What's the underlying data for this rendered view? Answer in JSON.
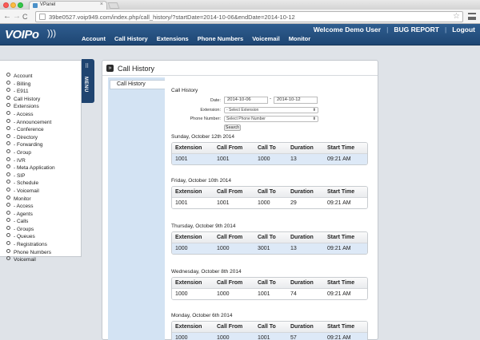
{
  "browser": {
    "tab_title": "VPanel",
    "tab_close": "×",
    "url": "39be0527.voip949.com/index.php/call_history/?startDate=2014-10-06&endDate=2014-10-12",
    "back": "←",
    "forward": "→",
    "reload": "C",
    "star": "☆"
  },
  "header": {
    "logo": "VOIPo",
    "logo_waves": ")))",
    "nav": [
      "Account",
      "Call History",
      "Extensions",
      "Phone Numbers",
      "Voicemail",
      "Monitor"
    ],
    "welcome": "Welcome Demo User",
    "sep1": "|",
    "bug_report": "BUG REPORT",
    "sep2": "|",
    "logout": "Logout"
  },
  "sidebar": {
    "menu_tab_label": "MENU",
    "menu_tab_icon": "⠿",
    "items": [
      "Account",
      "- Billing",
      "- E911",
      "Call History",
      "Extensions",
      "- Access",
      "- Announcement",
      "- Conference",
      "- Directory",
      "- Forwarding",
      "- Group",
      "- IVR",
      "- Meta Application",
      "- SIP",
      "- Schedule",
      "- Voicemail",
      "Monitor",
      "- Access",
      "- Agents",
      "- Calls",
      "- Groups",
      "- Queues",
      "- Registrations",
      "Phone Numbers",
      "Voicemail"
    ]
  },
  "panel": {
    "title": "Call History",
    "icon": "»",
    "subnav_item": "Call History",
    "section_title": "Call History",
    "date_label": "Date:",
    "start_date": "2014-10-06",
    "date_sep": "-",
    "end_date": "2014-10-12",
    "extension_label": "Extension:",
    "extension_select": "- Select Extension",
    "phone_label": "Phone Number:",
    "phone_select": "Select Phone Number",
    "select_arrow": "⬍",
    "search_button": "Search"
  },
  "table_headers": [
    "Extension",
    "Call From",
    "Call To",
    "Duration",
    "Start Time"
  ],
  "days": [
    {
      "title": "Sunday, October 12th 2014",
      "row": [
        "1001",
        "1001",
        "1000",
        "13",
        "09:21 AM"
      ],
      "shaded": true
    },
    {
      "title": "Friday, October 10th 2014",
      "row": [
        "1001",
        "1001",
        "1000",
        "29",
        "09:21 AM"
      ],
      "shaded": false
    },
    {
      "title": "Thursday, October 9th 2014",
      "row": [
        "1000",
        "1000",
        "3001",
        "13",
        "09:21 AM"
      ],
      "shaded": true
    },
    {
      "title": "Wednesday, October 8th 2014",
      "row": [
        "1000",
        "1000",
        "1001",
        "74",
        "09:21 AM"
      ],
      "shaded": false
    },
    {
      "title": "Monday, October 6th 2014",
      "row": [
        "1000",
        "1000",
        "1001",
        "57",
        "09:21 AM"
      ],
      "shaded": true
    }
  ],
  "colors": {
    "header_blue": "#1e4673",
    "subnav_blue": "#d3e3f3",
    "row_shade": "#dde9f7"
  }
}
